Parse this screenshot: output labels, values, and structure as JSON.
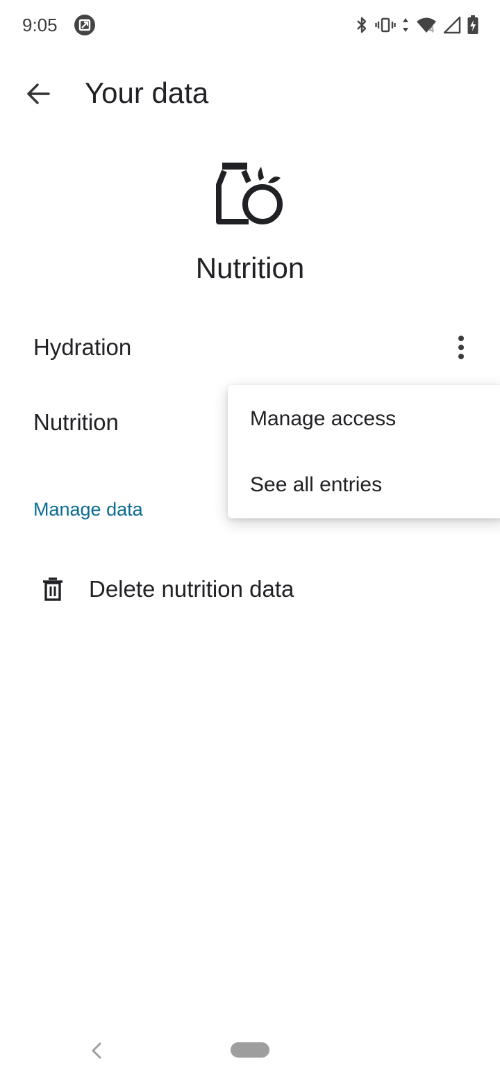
{
  "status_bar": {
    "time": "9:05",
    "notification_icon": "screenshot-notification-icon",
    "icons": [
      "bluetooth-icon",
      "vibrate-icon",
      "data-arrows-icon",
      "wifi-icon",
      "cell-signal-icon",
      "battery-charging-icon"
    ]
  },
  "app_bar": {
    "back_icon": "arrow-back-icon",
    "title": "Your data"
  },
  "header": {
    "icon": "nutrition-icon",
    "title": "Nutrition"
  },
  "data_types": [
    {
      "label": "Hydration"
    },
    {
      "label": "Nutrition"
    }
  ],
  "overflow_icon": "more-vert-icon",
  "manage_section": {
    "header": "Manage data",
    "delete_icon": "delete-icon",
    "delete_label": "Delete nutrition data"
  },
  "popup_menu": {
    "items": [
      {
        "label": "Manage access"
      },
      {
        "label": "See all entries"
      }
    ]
  },
  "nav_bar": {
    "back_icon": "nav-back-icon",
    "home_icon": "nav-home-pill-icon"
  },
  "colors": {
    "accent": "#0b6b93",
    "text_primary": "#202124",
    "background": "#ffffff"
  }
}
